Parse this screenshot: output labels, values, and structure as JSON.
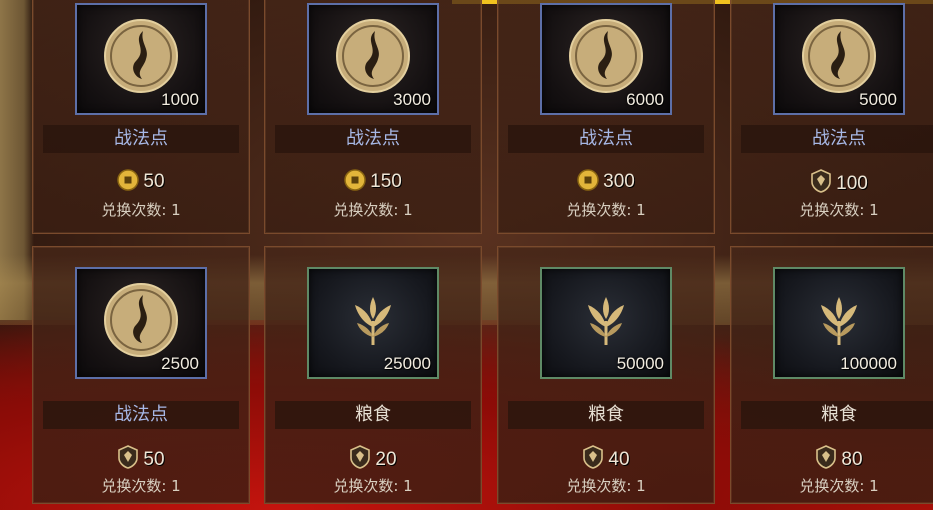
{
  "colors": {
    "frame_blue": "#5d6fa8",
    "frame_green": "#5f8a66",
    "name_blue": "#a7b8e6",
    "highlight": "#f1c21f"
  },
  "items": [
    {
      "name": "战法点",
      "qty": "1000",
      "price": "50",
      "currency": "coin-icon",
      "limit": "兑换次数: 1",
      "icon": "flame-medallion-icon"
    },
    {
      "name": "战法点",
      "qty": "3000",
      "price": "150",
      "currency": "coin-icon",
      "limit": "兑换次数: 1",
      "icon": "flame-medallion-icon"
    },
    {
      "name": "战法点",
      "qty": "6000",
      "price": "300",
      "currency": "coin-icon",
      "limit": "兑换次数: 1",
      "icon": "flame-medallion-icon"
    },
    {
      "name": "战法点",
      "qty": "5000",
      "price": "100",
      "currency": "shield-token-icon",
      "limit": "兑换次数: 1",
      "icon": "flame-medallion-icon"
    },
    {
      "name": "战法点",
      "qty": "2500",
      "price": "50",
      "currency": "shield-token-icon",
      "limit": "兑换次数: 1",
      "icon": "flame-medallion-icon"
    },
    {
      "name": "粮食",
      "qty": "25000",
      "price": "20",
      "currency": "shield-token-icon",
      "limit": "兑换次数: 1",
      "icon": "grain-icon"
    },
    {
      "name": "粮食",
      "qty": "50000",
      "price": "40",
      "currency": "shield-token-icon",
      "limit": "兑换次数: 1",
      "icon": "grain-icon"
    },
    {
      "name": "粮食",
      "qty": "100000",
      "price": "80",
      "currency": "shield-token-icon",
      "limit": "兑换次数: 1",
      "icon": "grain-icon"
    }
  ]
}
